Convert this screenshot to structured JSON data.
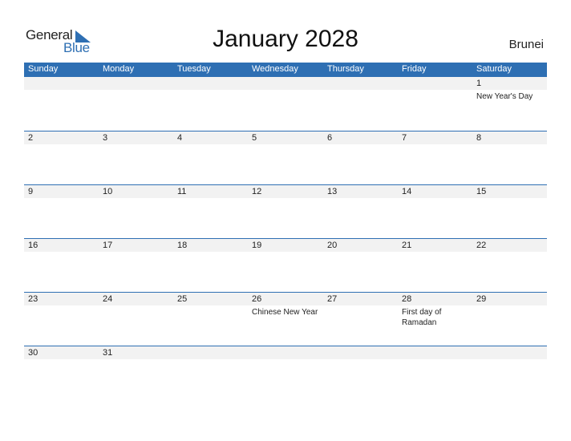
{
  "logo": {
    "line1": "General",
    "line2": "Blue"
  },
  "title": "January 2028",
  "country": "Brunei",
  "colors": {
    "accent": "#2e6fb3",
    "band": "#f2f2f2"
  },
  "weekdays": [
    "Sunday",
    "Monday",
    "Tuesday",
    "Wednesday",
    "Thursday",
    "Friday",
    "Saturday"
  ],
  "weeks": [
    [
      {
        "day": "",
        "event": ""
      },
      {
        "day": "",
        "event": ""
      },
      {
        "day": "",
        "event": ""
      },
      {
        "day": "",
        "event": ""
      },
      {
        "day": "",
        "event": ""
      },
      {
        "day": "",
        "event": ""
      },
      {
        "day": "1",
        "event": "New Year's Day"
      }
    ],
    [
      {
        "day": "2",
        "event": ""
      },
      {
        "day": "3",
        "event": ""
      },
      {
        "day": "4",
        "event": ""
      },
      {
        "day": "5",
        "event": ""
      },
      {
        "day": "6",
        "event": ""
      },
      {
        "day": "7",
        "event": ""
      },
      {
        "day": "8",
        "event": ""
      }
    ],
    [
      {
        "day": "9",
        "event": ""
      },
      {
        "day": "10",
        "event": ""
      },
      {
        "day": "11",
        "event": ""
      },
      {
        "day": "12",
        "event": ""
      },
      {
        "day": "13",
        "event": ""
      },
      {
        "day": "14",
        "event": ""
      },
      {
        "day": "15",
        "event": ""
      }
    ],
    [
      {
        "day": "16",
        "event": ""
      },
      {
        "day": "17",
        "event": ""
      },
      {
        "day": "18",
        "event": ""
      },
      {
        "day": "19",
        "event": ""
      },
      {
        "day": "20",
        "event": ""
      },
      {
        "day": "21",
        "event": ""
      },
      {
        "day": "22",
        "event": ""
      }
    ],
    [
      {
        "day": "23",
        "event": ""
      },
      {
        "day": "24",
        "event": ""
      },
      {
        "day": "25",
        "event": ""
      },
      {
        "day": "26",
        "event": "Chinese New Year"
      },
      {
        "day": "27",
        "event": ""
      },
      {
        "day": "28",
        "event": "First day of Ramadan"
      },
      {
        "day": "29",
        "event": ""
      }
    ],
    [
      {
        "day": "30",
        "event": ""
      },
      {
        "day": "31",
        "event": ""
      },
      {
        "day": "",
        "event": ""
      },
      {
        "day": "",
        "event": ""
      },
      {
        "day": "",
        "event": ""
      },
      {
        "day": "",
        "event": ""
      },
      {
        "day": "",
        "event": ""
      }
    ]
  ]
}
